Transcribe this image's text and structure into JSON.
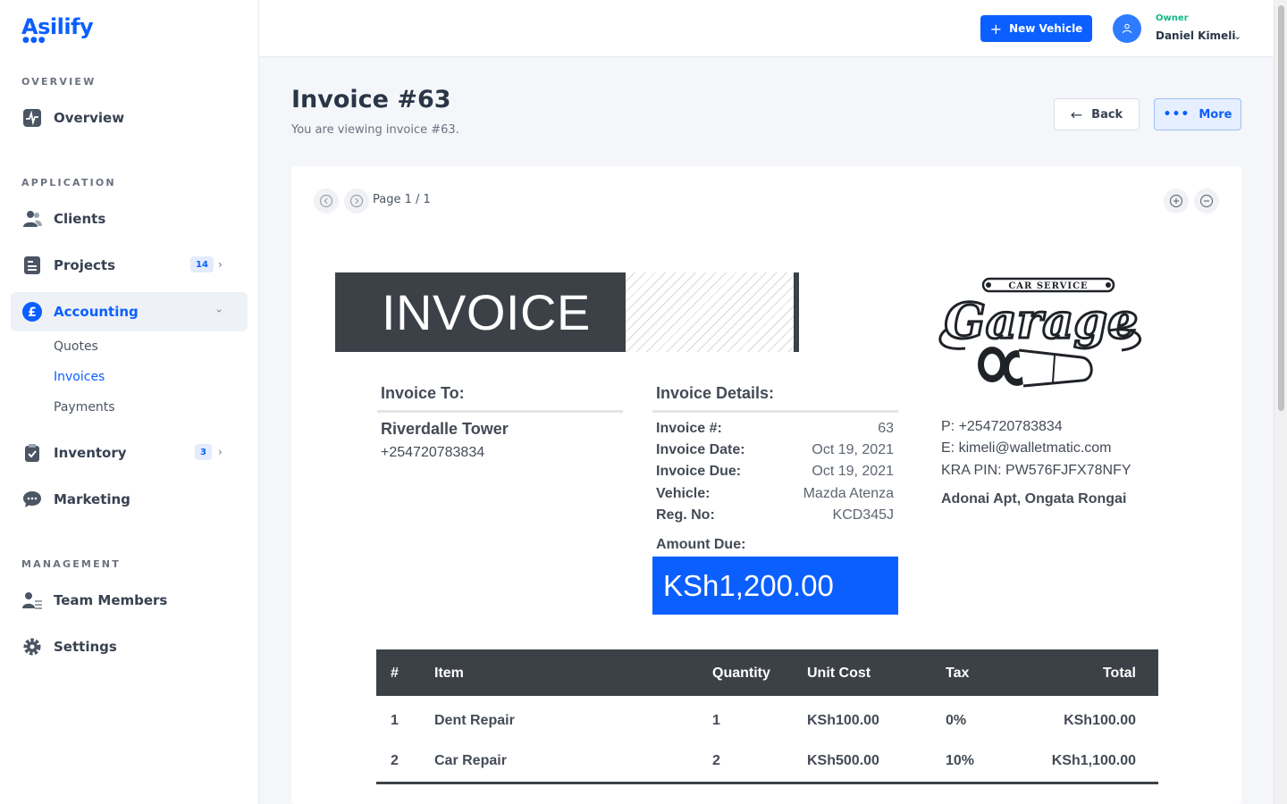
{
  "sidebar": {
    "brand": "Asilify",
    "sections": {
      "overview": "OVERVIEW",
      "application": "APPLICATION",
      "management": "MANAGEMENT"
    },
    "items": {
      "overview": "Overview",
      "clients": "Clients",
      "projects": "Projects",
      "projects_badge": "14",
      "accounting": "Accounting",
      "inventory": "Inventory",
      "inventory_badge": "3",
      "marketing": "Marketing",
      "team_members": "Team Members",
      "settings": "Settings"
    },
    "accounting_sub": {
      "quotes": "Quotes",
      "invoices": "Invoices",
      "payments": "Payments"
    }
  },
  "topbar": {
    "new_vehicle": "New Vehicle",
    "role": "Owner",
    "user_name": "Daniel Kimeli"
  },
  "page": {
    "title": "Invoice #63",
    "subtitle": "You are viewing invoice #63.",
    "back": "Back",
    "more": "More"
  },
  "viewer": {
    "page_label": "Page 1 / 1"
  },
  "invoice": {
    "banner": "INVOICE",
    "logo_top_text": "CAR SERVICE",
    "logo_text": "Garage",
    "to_heading": "Invoice To:",
    "client_name": "Riverdalle Tower",
    "client_phone": "+254720783834",
    "details_heading": "Invoice Details:",
    "details": {
      "number_label": "Invoice #:",
      "number": "63",
      "date_label": "Invoice Date:",
      "date": "Oct 19, 2021",
      "due_label": "Invoice Due:",
      "due": "Oct 19, 2021",
      "vehicle_label": "Vehicle:",
      "vehicle": "Mazda Atenza",
      "reg_label": "Reg. No:",
      "reg": "KCD345J"
    },
    "amount_due_label": "Amount Due:",
    "amount_due": "KSh1,200.00",
    "company": {
      "phone": "P: +254720783834",
      "email": "E: kimeli@walletmatic.com",
      "kra": "KRA PIN: PW576FJFX78NFY",
      "address": "Adonai Apt, Ongata Rongai"
    },
    "table": {
      "headers": {
        "num": "#",
        "item": "Item",
        "qty": "Quantity",
        "unit": "Unit Cost",
        "tax": "Tax",
        "total": "Total"
      },
      "rows": [
        {
          "num": "1",
          "item": "Dent Repair",
          "qty": "1",
          "unit": "KSh100.00",
          "tax": "0%",
          "total": "KSh100.00"
        },
        {
          "num": "2",
          "item": "Car Repair",
          "qty": "2",
          "unit": "KSh500.00",
          "tax": "10%",
          "total": "KSh1,100.00"
        }
      ]
    }
  },
  "colors": {
    "accent": "#0b5fff",
    "dark": "#3c4148",
    "owner_green": "#12b886"
  }
}
